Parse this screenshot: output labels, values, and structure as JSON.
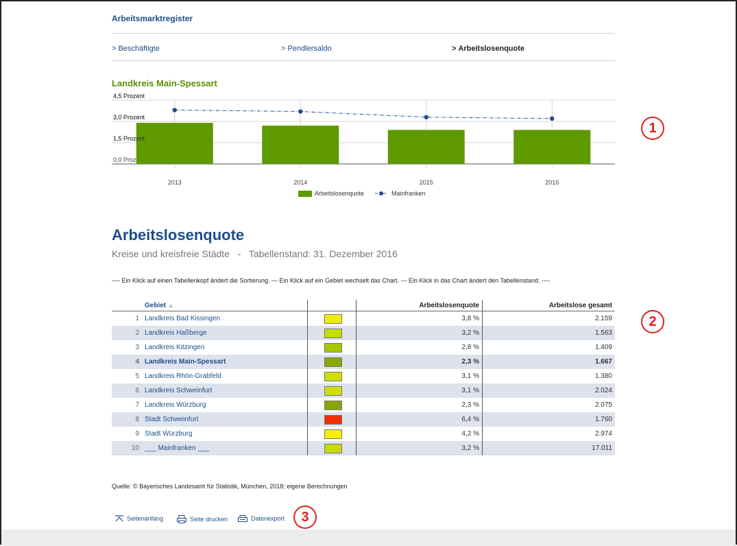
{
  "register_title": "Arbeitsmarktregister",
  "tabs": [
    {
      "arrow": ">",
      "label": "Beschäftigte",
      "active": false
    },
    {
      "arrow": ">",
      "label": "Pendlersaldo",
      "active": false
    },
    {
      "arrow": ">",
      "label": "Arbeitslosenquote",
      "active": true
    }
  ],
  "chart_data": {
    "type": "bar",
    "title": "Landkreis Main-Spessart",
    "categories": [
      "2013",
      "2014",
      "2015",
      "2016"
    ],
    "series": [
      {
        "name": "Arbeitslosenquote",
        "kind": "bar",
        "color": "#5f9900",
        "values": [
          2.9,
          2.7,
          2.4,
          2.4
        ]
      },
      {
        "name": "Mainfranken",
        "kind": "line",
        "color": "#1d4e89",
        "values": [
          3.8,
          3.7,
          3.3,
          3.2
        ]
      }
    ],
    "yticks": [
      "0,0 Prozent",
      "1,5 Prozent",
      "3,0 Prozent",
      "4,5 Prozent"
    ],
    "ylim": [
      0,
      4.5
    ],
    "legend_position": "bottom"
  },
  "heading": "Arbeitslosenquote",
  "subtitle": "Kreise und kreisfreie Städte   -   Tabellenstand: 31. Dezember 2016",
  "hint": "---- Ein Klick auf einen Tabellenkopf ändert die Sortierung. --- Ein Klick auf ein Gebiet wechselt das Chart. --- Ein Klick in das Chart ändert den Tabellenstand. ----",
  "table": {
    "headers": {
      "gebiet": "Gebiet",
      "quote": "Arbeitslosenquote",
      "gesamt": "Arbeitslose gesamt"
    },
    "rows": [
      {
        "no": "1",
        "name": "Landkreis Bad Kissingen",
        "color": "#f0ee00",
        "quote": "3,8 %",
        "gesamt": "2.159"
      },
      {
        "no": "2",
        "name": "Landkreis Haßberge",
        "color": "#c6db00",
        "quote": "3,2 %",
        "gesamt": "1.563"
      },
      {
        "no": "3",
        "name": "Landkreis Kitzingen",
        "color": "#a9c800",
        "quote": "2,8 %",
        "gesamt": "1.409"
      },
      {
        "no": "4",
        "name": "Landkreis Main-Spessart",
        "color": "#8ba600",
        "quote": "2,3 %",
        "gesamt": "1.667"
      },
      {
        "no": "5",
        "name": "Landkreis Rhön-Grabfeld",
        "color": "#cfe000",
        "quote": "3,1 %",
        "gesamt": "1.380"
      },
      {
        "no": "6",
        "name": "Landkreis Schweinfurt",
        "color": "#cfe000",
        "quote": "3,1 %",
        "gesamt": "2.024"
      },
      {
        "no": "7",
        "name": "Landkreis Würzburg",
        "color": "#8ba600",
        "quote": "2,3 %",
        "gesamt": "2.075"
      },
      {
        "no": "8",
        "name": "Stadt Schweinfurt",
        "color": "#f03000",
        "quote": "6,4 %",
        "gesamt": "1.760"
      },
      {
        "no": "9",
        "name": "Stadt Würzburg",
        "color": "#f8f000",
        "quote": "4,2 %",
        "gesamt": "2.974"
      },
      {
        "no": "10",
        "name": "___ Mainfranken ___",
        "color": "#c6db00",
        "quote": "3,2 %",
        "gesamt": "17.011"
      }
    ]
  },
  "source": "Quelle: © Bayerisches Landesamt für Statistik, München, 2018; eigene Berechnungen",
  "footer_links": {
    "top": "Seitenanfang",
    "print": "Seite drucken",
    "export": "Datenexport"
  },
  "annotations": [
    "1",
    "2",
    "3"
  ]
}
